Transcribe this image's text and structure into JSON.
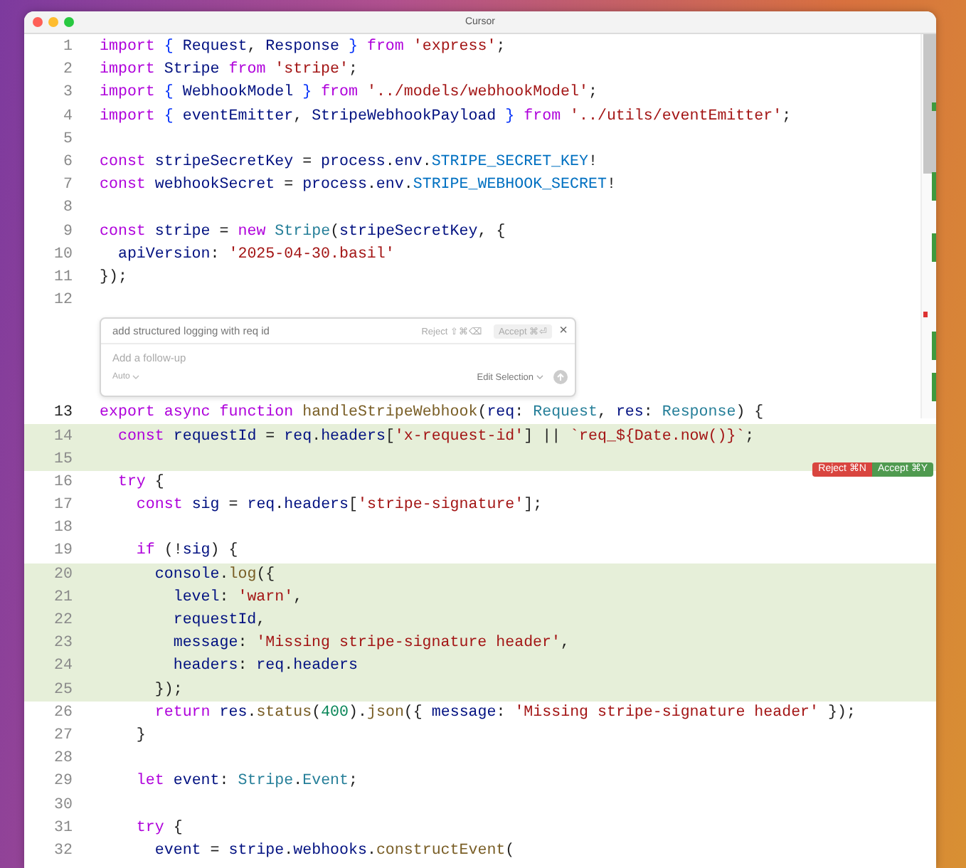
{
  "window": {
    "title": "Cursor"
  },
  "editor": {
    "lines_top": [
      {
        "number": "1",
        "current": false,
        "added": false,
        "code": "import { Request, Response } from 'express';"
      },
      {
        "number": "2",
        "current": false,
        "added": false,
        "code": "import Stripe from 'stripe';"
      },
      {
        "number": "3",
        "current": false,
        "added": false,
        "code": "import { WebhookModel } from '../models/webhookModel';"
      },
      {
        "number": "4",
        "current": false,
        "added": false,
        "code": "import { eventEmitter, StripeWebhookPayload } from '../utils/eventEmitter';"
      },
      {
        "number": "5",
        "current": false,
        "added": false
      },
      {
        "number": "6",
        "current": false,
        "added": false,
        "code": "const stripeSecretKey = process.env.STRIPE_SECRET_KEY!"
      },
      {
        "number": "7",
        "current": false,
        "added": false,
        "code": "const webhookSecret = process.env.STRIPE_WEBHOOK_SECRET!"
      },
      {
        "number": "8",
        "current": false,
        "added": false
      },
      {
        "number": "9",
        "current": false,
        "added": false,
        "code": "const stripe = new Stripe(stripeSecretKey, {"
      },
      {
        "number": "10",
        "current": false,
        "added": false,
        "code": "  apiVersion: '2025-04-30.basil'"
      },
      {
        "number": "11",
        "current": false,
        "added": false,
        "code": "});"
      },
      {
        "number": "12",
        "current": false,
        "added": false
      }
    ],
    "inline_edit": {
      "prompt": "add structured logging with req id",
      "reject": "Reject ⇧⌘⌫",
      "accept": "Accept ⌘⏎",
      "close": "×",
      "placeholder": "Add a follow-up",
      "mode": "Auto",
      "action": "Edit Selection"
    },
    "lines_bottom": [
      {
        "number": "13",
        "current": true,
        "added": false,
        "code": "export async function handleStripeWebhook(req: Request, res: Response) {"
      },
      {
        "number": "14",
        "current": false,
        "added": true,
        "code": "  const requestId = req.headers['x-request-id'] || `req_${Date.now()}`;"
      },
      {
        "number": "15",
        "current": false,
        "added": true
      },
      {
        "number": "16",
        "current": false,
        "added": false,
        "code": "  try {",
        "actions": [
          {
            "kind": "reject",
            "label": "Reject ⌘N"
          },
          {
            "kind": "accept",
            "label": "Accept ⌘Y"
          }
        ]
      },
      {
        "number": "17",
        "current": false,
        "added": false,
        "code": "    const sig = req.headers['stripe-signature'];"
      },
      {
        "number": "18",
        "current": false,
        "added": false
      },
      {
        "number": "19",
        "current": false,
        "added": false,
        "code": "    if (!sig) {"
      },
      {
        "number": "20",
        "current": false,
        "added": true,
        "code": "      console.log({"
      },
      {
        "number": "21",
        "current": false,
        "added": true,
        "code": "        level: 'warn',"
      },
      {
        "number": "22",
        "current": false,
        "added": true,
        "code": "        requestId,"
      },
      {
        "number": "23",
        "current": false,
        "added": true,
        "code": "        message: 'Missing stripe-signature header',"
      },
      {
        "number": "24",
        "current": false,
        "added": true,
        "code": "        headers: req.headers"
      },
      {
        "number": "25",
        "current": false,
        "added": true,
        "code": "      });"
      },
      {
        "number": "26",
        "current": false,
        "added": false,
        "code": "      return res.status(400).json({ message: 'Missing stripe-signature header' });"
      },
      {
        "number": "27",
        "current": false,
        "added": false,
        "code": "    }"
      },
      {
        "number": "28",
        "current": false,
        "added": false
      },
      {
        "number": "29",
        "current": false,
        "added": false,
        "code": "    let event: Stripe.Event;"
      },
      {
        "number": "30",
        "current": false,
        "added": false
      },
      {
        "number": "31",
        "current": false,
        "added": false,
        "code": "    try {"
      },
      {
        "number": "32",
        "current": false,
        "added": false,
        "code": "      event = stripe.webhooks.constructEvent("
      }
    ]
  }
}
